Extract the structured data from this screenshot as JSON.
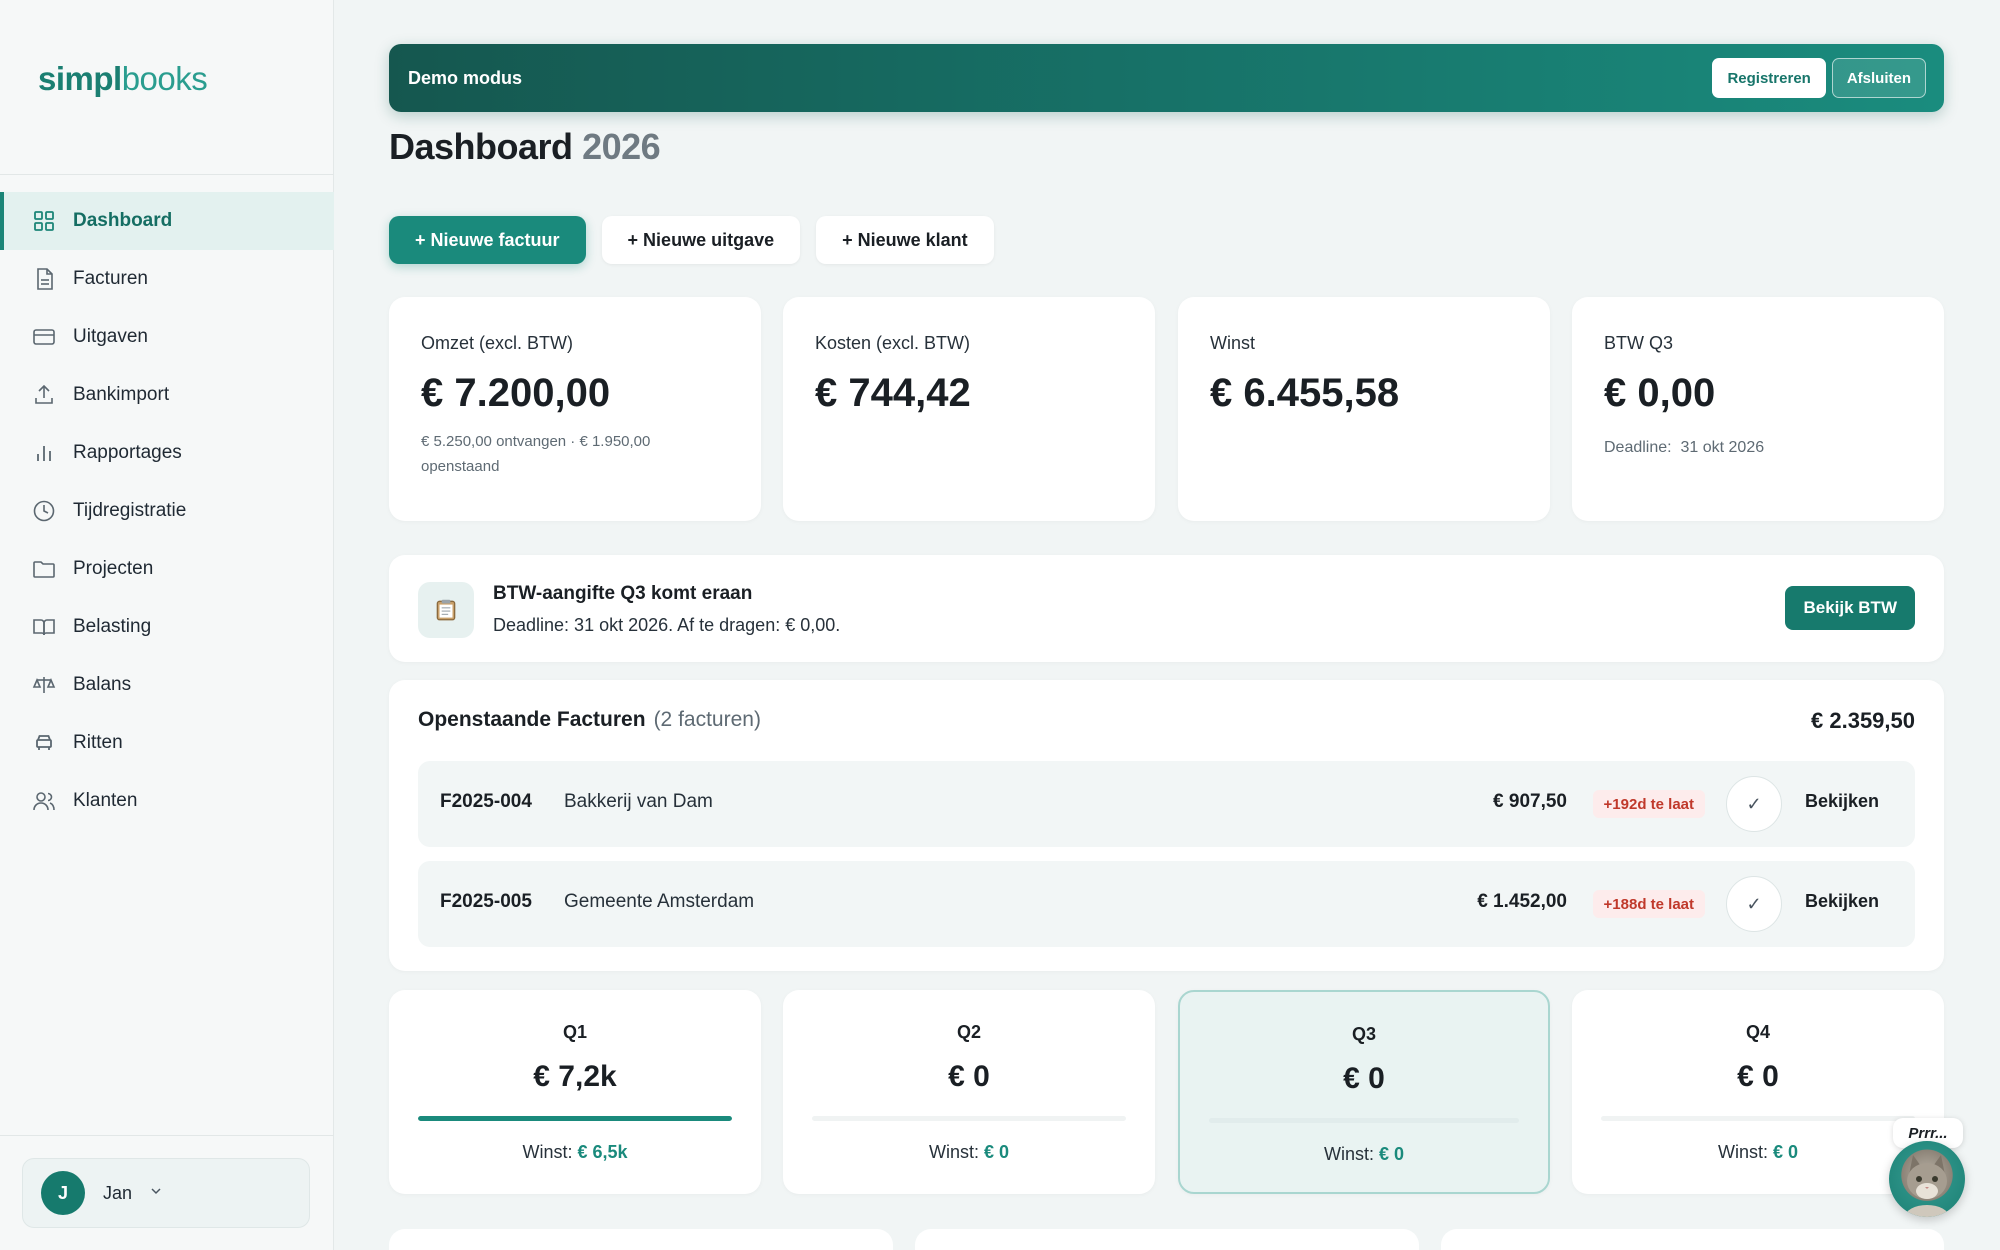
{
  "app": {
    "logo_part1": "simpl",
    "logo_part2": "books"
  },
  "sidebar": {
    "items": [
      {
        "label": "Dashboard",
        "icon": "grid-icon",
        "active": true
      },
      {
        "label": "Facturen",
        "icon": "document-icon"
      },
      {
        "label": "Uitgaven",
        "icon": "credit-card-icon"
      },
      {
        "label": "Bankimport",
        "icon": "upload-icon"
      },
      {
        "label": "Rapportages",
        "icon": "bar-chart-icon"
      },
      {
        "label": "Tijdregistratie",
        "icon": "clock-icon"
      },
      {
        "label": "Projecten",
        "icon": "folder-icon"
      },
      {
        "label": "Belasting",
        "icon": "book-open-icon"
      },
      {
        "label": "Balans",
        "icon": "scale-icon"
      },
      {
        "label": "Ritten",
        "icon": "car-icon"
      },
      {
        "label": "Klanten",
        "icon": "users-icon"
      }
    ],
    "user": {
      "initial": "J",
      "name": "Jan"
    }
  },
  "demo_bar": {
    "label": "Demo modus",
    "register_label": "Registreren",
    "exit_label": "Afsluiten"
  },
  "page": {
    "title": "Dashboard",
    "year": "2026"
  },
  "actions": {
    "new_invoice": "+ Nieuwe factuur",
    "new_expense": "+ Nieuwe uitgave",
    "new_client": "+ Nieuwe klant"
  },
  "kpis": {
    "revenue": {
      "label": "Omzet (excl. BTW)",
      "value": "€ 7.200,00",
      "sub": "€ 5.250,00 ontvangen · € 1.950,00 openstaand"
    },
    "costs": {
      "label": "Kosten (excl. BTW)",
      "value": "€ 744,42"
    },
    "profit": {
      "label": "Winst",
      "value": "€ 6.455,58"
    },
    "vat": {
      "label": "BTW Q3",
      "value": "€ 0,00",
      "deadline_label": "Deadline:",
      "deadline": "31 okt 2026"
    }
  },
  "alert": {
    "icon": "clipboard-icon",
    "title": "BTW-aangifte Q3 komt eraan",
    "text": "Deadline: 31 okt 2026. Af te dragen: € 0,00.",
    "button": "Bekijk BTW"
  },
  "invoices": {
    "title": "Openstaande Facturen",
    "count": "(2 facturen)",
    "total": "€ 2.359,50",
    "rows": [
      {
        "number": "F2025-004",
        "client": "Bakkerij van Dam",
        "amount": "€ 907,50",
        "late": "+192d te laat",
        "check": "✓",
        "action": "Bekijken"
      },
      {
        "number": "F2025-005",
        "client": "Gemeente Amsterdam",
        "amount": "€ 1.452,00",
        "late": "+188d te laat",
        "check": "✓",
        "action": "Bekijken"
      }
    ]
  },
  "quarters": [
    {
      "label": "Q1",
      "value": "€ 7,2k",
      "profit_label": "Winst:",
      "profit": "€ 6,5k",
      "progress": 1.0
    },
    {
      "label": "Q2",
      "value": "€ 0",
      "profit_label": "Winst:",
      "profit": "€ 0",
      "progress": 0
    },
    {
      "label": "Q3",
      "value": "€ 0",
      "profit_label": "Winst:",
      "profit": "€ 0",
      "progress": 0,
      "current": true
    },
    {
      "label": "Q4",
      "value": "€ 0",
      "profit_label": "Winst:",
      "profit": "€ 0",
      "progress": 0
    }
  ],
  "mascot": {
    "bubble": "Prrr..."
  },
  "colors": {
    "accent": "#1a8a7c",
    "late": "#c0392b"
  }
}
